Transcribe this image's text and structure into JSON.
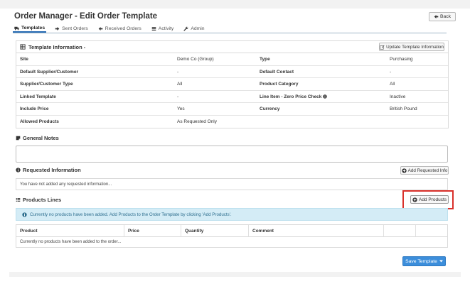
{
  "page": {
    "title": "Order Manager - Edit Order Template",
    "back_label": "Back"
  },
  "tabs": [
    {
      "label": "Templates",
      "icon": "truck-icon",
      "active": true
    },
    {
      "label": "Sent Orders",
      "icon": "arrow-right-icon",
      "active": false
    },
    {
      "label": "Received Orders",
      "icon": "arrow-left-icon",
      "active": false
    },
    {
      "label": "Activity",
      "icon": "list-icon",
      "active": false
    },
    {
      "label": "Admin",
      "icon": "wrench-icon",
      "active": false
    }
  ],
  "template_info": {
    "heading": "Template Information -",
    "update_label": "Update Template Information",
    "rows": [
      {
        "label1": "Site",
        "value1": "Demo Co (Group)",
        "label2": "Type",
        "value2": "Purchasing"
      },
      {
        "label1": "Default Supplier/Customer",
        "value1": "-",
        "label2": "Default Contact",
        "value2": "-"
      },
      {
        "label1": "Supplier/Customer Type",
        "value1": "All",
        "label2": "Product Category",
        "value2": "All"
      },
      {
        "label1": "Linked Template",
        "value1": "-",
        "label2": "Line Item - Zero Price Check",
        "value2": "Inactive"
      },
      {
        "label1": "Include Price",
        "value1": "Yes",
        "label2": "Currency",
        "value2": "British Pound"
      },
      {
        "label1": "Allowed Products",
        "value1": "As Requested Only",
        "label2": "",
        "value2": ""
      }
    ]
  },
  "general_notes": {
    "heading": "General Notes",
    "value": ""
  },
  "requested_info": {
    "heading": "Requested Information",
    "add_label": "Add Requested Info",
    "empty_text": "You have not added any requested information..."
  },
  "products": {
    "heading": "Products Lines",
    "add_label": "Add Products",
    "alert_text": "Currently no products have been added. Add Products to the Order Template by clicking 'Add Products'.",
    "columns": [
      "Product",
      "Price",
      "Quantity",
      "Comment",
      "",
      ""
    ],
    "empty_text": "Currently no products have been added to the order..."
  },
  "save": {
    "label": "Save Template"
  },
  "colors": {
    "primary": "#3c8edb",
    "alert_bg": "#d4ecf6",
    "highlight": "#d9302a"
  }
}
